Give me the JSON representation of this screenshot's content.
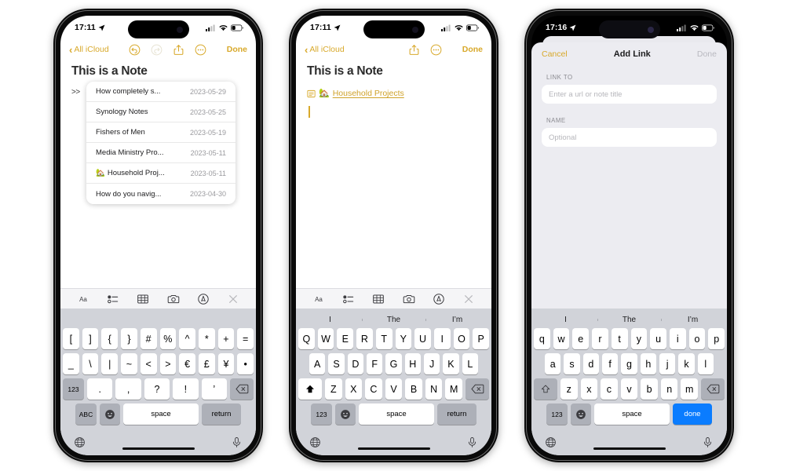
{
  "phones": [
    {
      "id": "phone-notes-suggestions",
      "statusbar": {
        "time": "17:11",
        "location_icon": "location-arrow-icon",
        "cellular_icon": "cellular-bars-icon",
        "wifi_icon": "wifi-icon",
        "battery_icon": "battery-low-icon"
      },
      "navbar": {
        "back_label": "All iCloud",
        "icons": [
          "undo-icon",
          "redo-icon",
          "share-icon",
          "more-ellipsis-icon"
        ],
        "done_label": "Done"
      },
      "note": {
        "title": "This is a Note",
        "typed_text": ">>"
      },
      "suggestions": [
        {
          "title": "How completely s...",
          "date": "2023-05-29",
          "emoji": ""
        },
        {
          "title": "Synology Notes",
          "date": "2023-05-25",
          "emoji": ""
        },
        {
          "title": "Fishers of Men",
          "date": "2023-05-19",
          "emoji": ""
        },
        {
          "title": "Media Ministry Pro...",
          "date": "2023-05-11",
          "emoji": ""
        },
        {
          "title": "Household Proj...",
          "date": "2023-05-11",
          "emoji": "🏡"
        },
        {
          "title": "How do you navig...",
          "date": "2023-04-30",
          "emoji": ""
        }
      ],
      "edit_toolbar": [
        "format-aa-icon",
        "checklist-icon",
        "table-icon",
        "camera-icon",
        "markup-pen-icon",
        "close-icon"
      ],
      "keyboard": {
        "type": "symbols",
        "predictive": [],
        "rows": [
          [
            "[",
            "]",
            "{",
            "}",
            "#",
            "%",
            "^",
            "*",
            "+",
            "="
          ],
          [
            "_",
            "\\",
            "|",
            "~",
            "<",
            ">",
            "€",
            "£",
            "¥",
            "•"
          ],
          [
            "123",
            ".",
            ",",
            "?",
            "!",
            "’",
            "delete-icon"
          ],
          [
            "ABC",
            "emoji-icon",
            "space",
            "return"
          ]
        ]
      },
      "bottom": {
        "globe_icon": "globe-icon",
        "mic_icon": "microphone-icon"
      }
    },
    {
      "id": "phone-notes-link-inserted",
      "statusbar": {
        "time": "17:11",
        "location_icon": "location-arrow-icon",
        "cellular_icon": "cellular-bars-icon",
        "wifi_icon": "wifi-icon",
        "battery_icon": "battery-low-icon"
      },
      "navbar": {
        "back_label": "All iCloud",
        "icons": [
          "share-icon",
          "more-ellipsis-icon"
        ],
        "done_label": "Done"
      },
      "note": {
        "title": "This is a Note",
        "link_icon": "note-link-icon",
        "link_emoji": "🏡",
        "link_text": "Household Projects"
      },
      "edit_toolbar": [
        "format-aa-icon",
        "checklist-icon",
        "table-icon",
        "camera-icon",
        "markup-pen-icon",
        "close-icon"
      ],
      "keyboard": {
        "type": "qwerty-upper",
        "predictive": [
          "I",
          "The",
          "I’m"
        ],
        "rows": [
          [
            "Q",
            "W",
            "E",
            "R",
            "T",
            "Y",
            "U",
            "I",
            "O",
            "P"
          ],
          [
            "A",
            "S",
            "D",
            "F",
            "G",
            "H",
            "J",
            "K",
            "L"
          ],
          [
            "shift-icon",
            "Z",
            "X",
            "C",
            "V",
            "B",
            "N",
            "M",
            "delete-icon"
          ],
          [
            "123",
            "emoji-icon",
            "space",
            "return"
          ]
        ]
      },
      "bottom": {
        "globe_icon": "globe-icon",
        "mic_icon": "microphone-icon"
      }
    },
    {
      "id": "phone-add-link-sheet",
      "statusbar": {
        "time": "17:16",
        "location_icon": "location-arrow-icon",
        "cellular_icon": "cellular-bars-icon",
        "wifi_icon": "wifi-icon",
        "battery_icon": "battery-low-icon"
      },
      "sheet": {
        "cancel_label": "Cancel",
        "title": "Add Link",
        "done_label": "Done",
        "fields": [
          {
            "label": "LINK TO",
            "value": "",
            "placeholder": "Enter a url or note title"
          },
          {
            "label": "NAME",
            "value": "",
            "placeholder": "Optional"
          }
        ]
      },
      "keyboard": {
        "type": "qwerty-lower",
        "predictive": [
          "I",
          "The",
          "I’m"
        ],
        "rows": [
          [
            "q",
            "w",
            "e",
            "r",
            "t",
            "y",
            "u",
            "i",
            "o",
            "p"
          ],
          [
            "a",
            "s",
            "d",
            "f",
            "g",
            "h",
            "j",
            "k",
            "l"
          ],
          [
            "shift-icon",
            "z",
            "x",
            "c",
            "v",
            "b",
            "n",
            "m",
            "delete-icon"
          ],
          [
            "123",
            "emoji-icon",
            "space",
            "done"
          ]
        ]
      },
      "bottom": {
        "globe_icon": "globe-icon",
        "mic_icon": "microphone-icon"
      }
    }
  ],
  "colors": {
    "accent_gold": "#d8a92b",
    "link_gold": "#cfa22a",
    "key_blue": "#0a7cff",
    "keyboard_bg": "#d1d3d9"
  }
}
